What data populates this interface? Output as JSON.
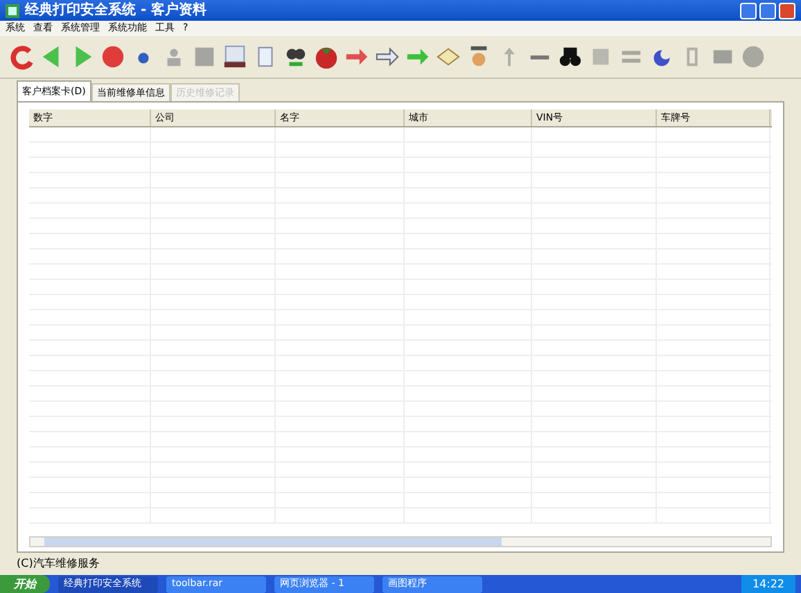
{
  "window": {
    "title": "经典打印安全系统 - 客户资料"
  },
  "menu": [
    "系统",
    "查看",
    "系统管理",
    "系统功能",
    "工具",
    "?"
  ],
  "tabs": [
    {
      "label": "客户档案卡(D)",
      "selected": true,
      "disabled": false
    },
    {
      "label": "当前维修单信息",
      "selected": false,
      "disabled": false
    },
    {
      "label": "历史维修记录",
      "selected": false,
      "disabled": true
    }
  ],
  "table": {
    "columns": [
      "数字",
      "公司",
      "名字",
      "城市",
      "VIN号",
      "车牌号"
    ]
  },
  "status_bar": "(C)汽车维修服务",
  "taskbar": {
    "start": "开始",
    "items": [
      {
        "label": "经典打印安全系统",
        "selected": true
      },
      {
        "label": "toolbar.rar",
        "selected": false
      },
      {
        "label": "网页浏览器 - 1",
        "selected": false
      },
      {
        "label": "画图程序",
        "selected": false
      }
    ],
    "clock": "14:22"
  }
}
